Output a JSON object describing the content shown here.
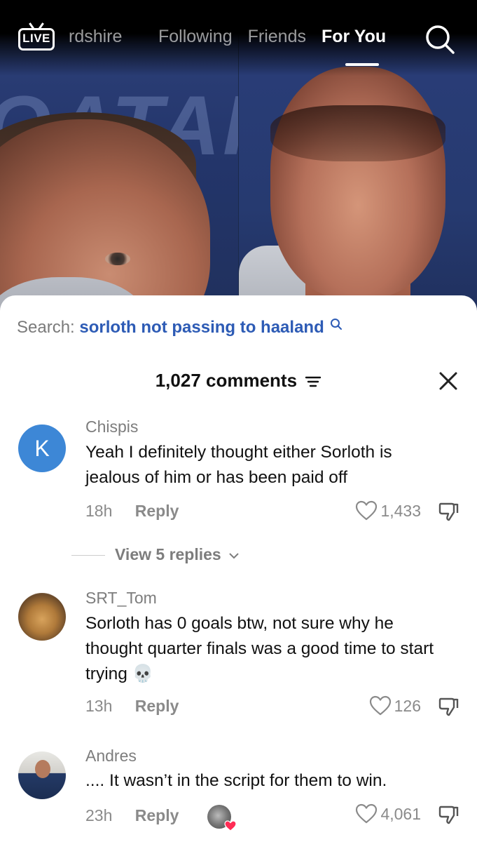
{
  "nav": {
    "live_label": "LIVE",
    "tabs": [
      {
        "label": "Staffordshire",
        "visible": "rdshire"
      },
      {
        "label": "Following"
      },
      {
        "label": "Friends"
      },
      {
        "label": "For You",
        "active": true
      }
    ]
  },
  "video": {
    "background_text": "QATAR"
  },
  "comments_sheet": {
    "search_label": "Search:",
    "search_query": "sorloth not passing to haaland",
    "count_label": "1,027 comments",
    "comments": [
      {
        "username": "Chispis",
        "avatar_letter": "K",
        "text": "Yeah I definitely thought either Sorloth is jealous of him or has been paid off",
        "time": "18h",
        "reply_label": "Reply",
        "likes": "1,433",
        "view_replies": "View 5 replies"
      },
      {
        "username": "SRT_Tom",
        "text": "Sorloth has 0 goals btw, not sure why he thought quarter finals was a good time to start trying 💀",
        "time": "13h",
        "reply_label": "Reply",
        "likes": "126"
      },
      {
        "username": "Andres",
        "text": ".... It wasn’t in the script for them to win.",
        "time": "23h",
        "reply_label": "Reply",
        "likes": "4,061",
        "liked_by_creator": true
      }
    ]
  },
  "colors": {
    "query_blue": "#2d5bb5",
    "avatar_blue": "#3d87d6",
    "creator_heart": "#ff2c55"
  }
}
